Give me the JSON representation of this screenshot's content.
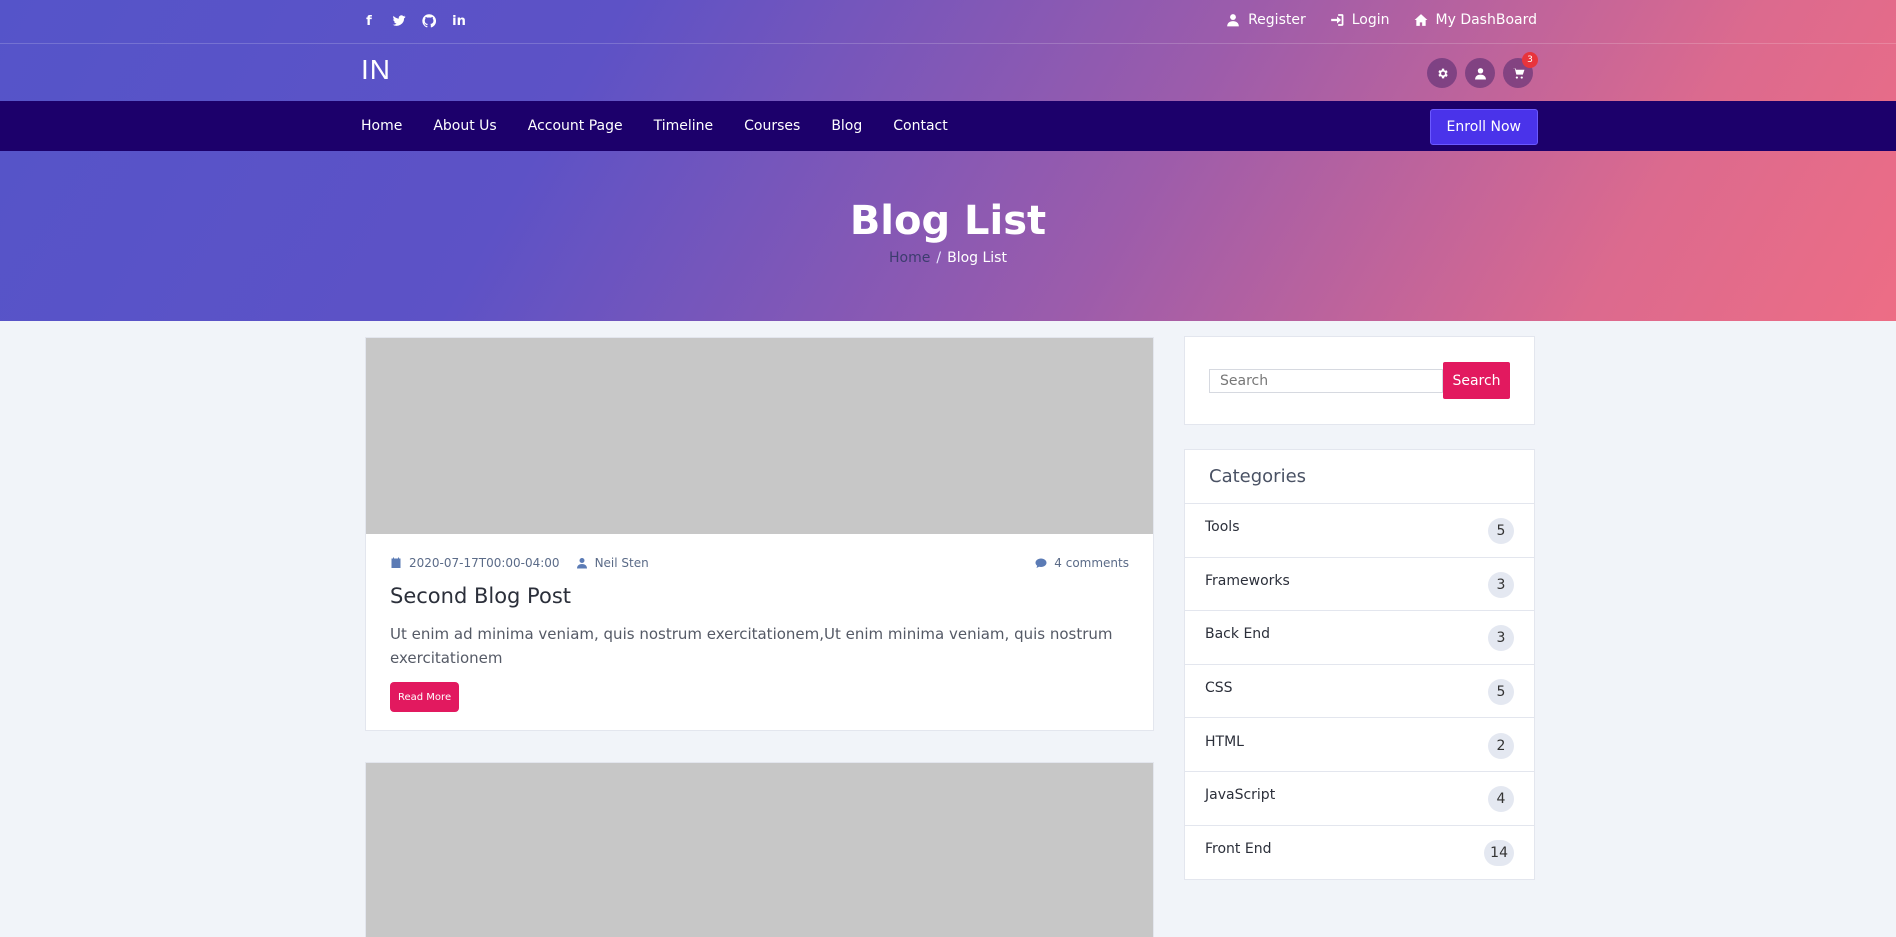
{
  "topbar": {
    "social_icons": [
      "facebook-icon",
      "twitter-icon",
      "github-icon",
      "linkedin-icon"
    ],
    "links": [
      {
        "label": "Register",
        "icon": "user-icon"
      },
      {
        "label": "Login",
        "icon": "sign-in-icon"
      },
      {
        "label": "My DashBoard",
        "icon": "home-icon"
      }
    ]
  },
  "header": {
    "logo": "IN",
    "icons": [
      "gear-icon",
      "user-icon",
      "cart-icon"
    ],
    "cart_count": "3"
  },
  "nav": {
    "items": [
      "Home",
      "About Us",
      "Account Page",
      "Timeline",
      "Courses",
      "Blog",
      "Contact"
    ],
    "enroll_label": "Enroll Now"
  },
  "hero": {
    "title": "Blog List",
    "breadcrumb_home": "Home",
    "breadcrumb_sep": "/",
    "breadcrumb_current": "Blog List"
  },
  "posts": [
    {
      "date": "2020-07-17T00:00-04:00",
      "author": "Neil Sten",
      "comments": "4 comments",
      "title": "Second Blog Post",
      "excerpt": "Ut enim ad minima veniam, quis nostrum exercitationem,Ut enim minima veniam, quis nostrum exercitationem",
      "read_more": "Read More"
    }
  ],
  "sidebar": {
    "search_placeholder": "Search",
    "search_button": "Search",
    "categories_title": "Categories",
    "categories": [
      {
        "name": "Tools",
        "count": "5"
      },
      {
        "name": "Frameworks",
        "count": "3"
      },
      {
        "name": "Back End",
        "count": "3"
      },
      {
        "name": "CSS",
        "count": "5"
      },
      {
        "name": "HTML",
        "count": "2"
      },
      {
        "name": "JavaScript",
        "count": "4"
      },
      {
        "name": "Front End",
        "count": "14"
      }
    ]
  },
  "colors": {
    "nav_bg": "#1c006b",
    "accent_pink": "#e2195f",
    "enroll_blue": "#4a33ea",
    "placeholder_image": "#c7c7c7"
  }
}
